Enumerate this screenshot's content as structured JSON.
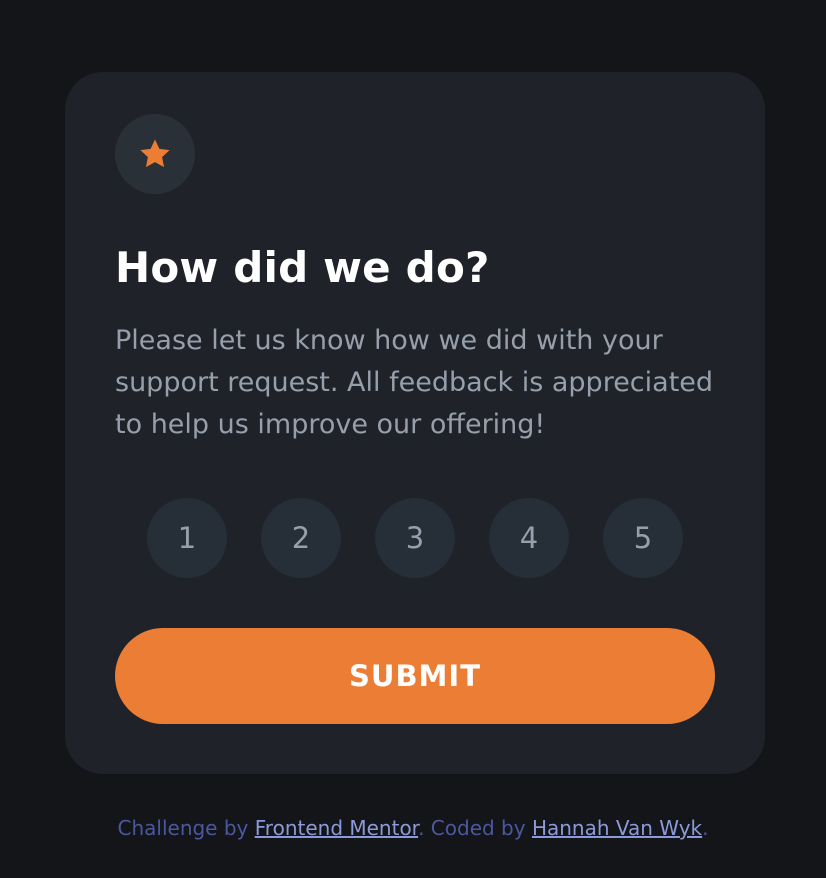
{
  "card": {
    "star_icon": "star-icon",
    "title": "How did we do?",
    "description": "Please let us know how we did with your support request. All feedback is appreciated to help us improve our offering!",
    "ratings": [
      "1",
      "2",
      "3",
      "4",
      "5"
    ],
    "submit_label": "SUBMIT"
  },
  "attribution": {
    "prefix": "Challenge by ",
    "link1": "Frontend Mentor",
    "middle": ". Coded by ",
    "link2": "Hannah Van Wyk",
    "suffix": "."
  },
  "colors": {
    "background": "#131518",
    "card": "#1f2329",
    "accent": "#ec7d34",
    "muted_text": "#969fab",
    "rating_button": "#262e38",
    "attribution_text": "#4c57a1",
    "attribution_link": "#8c9ad9"
  }
}
